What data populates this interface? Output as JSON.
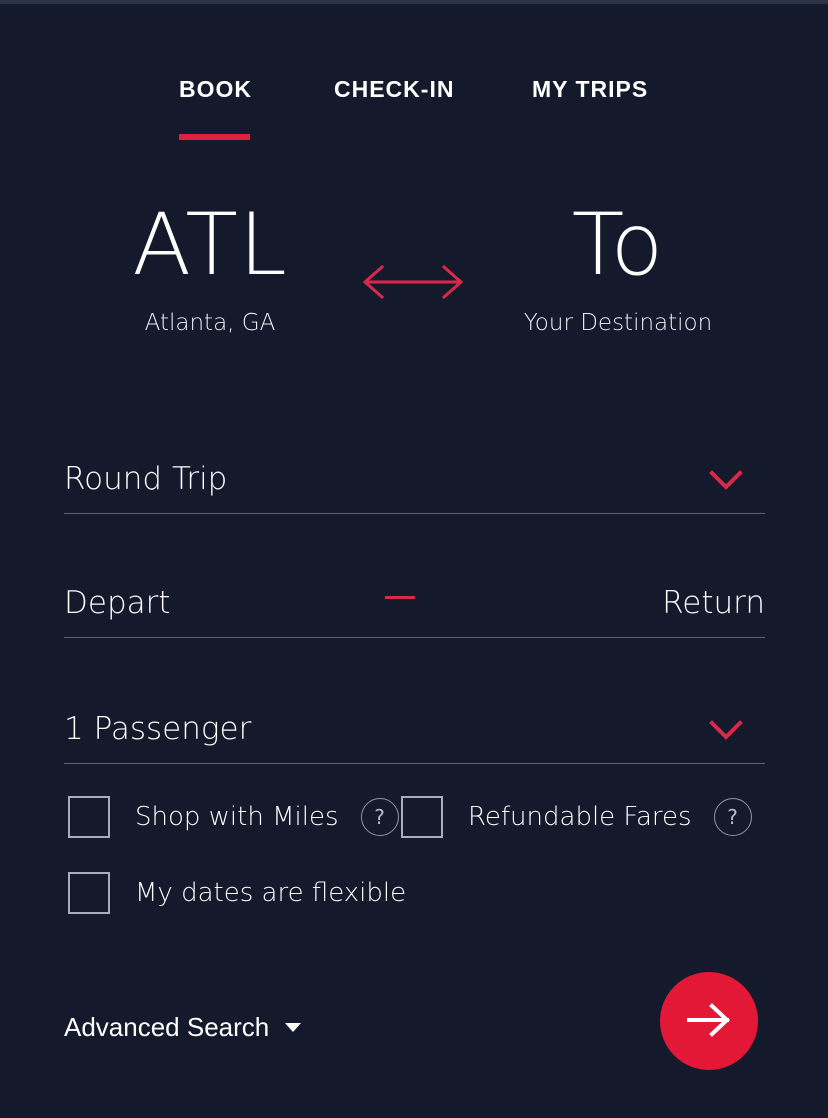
{
  "theme": {
    "background": "#141a2b",
    "accent_red": "#e31837",
    "underline_red": "#e0203f",
    "divider": "#59627a",
    "text": "#ffffff"
  },
  "tabs": [
    {
      "label": "BOOK",
      "active": true
    },
    {
      "label": "CHECK-IN",
      "active": false
    },
    {
      "label": "MY TRIPS",
      "active": false
    }
  ],
  "route": {
    "origin": {
      "code": "ATL",
      "city": "Atlanta, GA"
    },
    "destination": {
      "code": "To",
      "city": "Your Destination"
    },
    "swap_icon": "swap-horizontal-icon"
  },
  "form": {
    "trip_type": {
      "value": "Round Trip",
      "chevron_icon": "chevron-down-icon"
    },
    "dates": {
      "depart": "Depart",
      "return": "Return",
      "separator": "—"
    },
    "passengers": {
      "value": "1 Passenger",
      "chevron_icon": "chevron-down-icon"
    },
    "options": [
      {
        "label": "Shop with Miles",
        "checked": false,
        "help": "?"
      },
      {
        "label": "Refundable Fares",
        "checked": false,
        "help": "?"
      },
      {
        "label": "My dates are flexible",
        "checked": false
      }
    ]
  },
  "footer": {
    "advanced_search": "Advanced Search",
    "caret_icon": "caret-down-icon",
    "submit_icon": "arrow-right-icon"
  }
}
